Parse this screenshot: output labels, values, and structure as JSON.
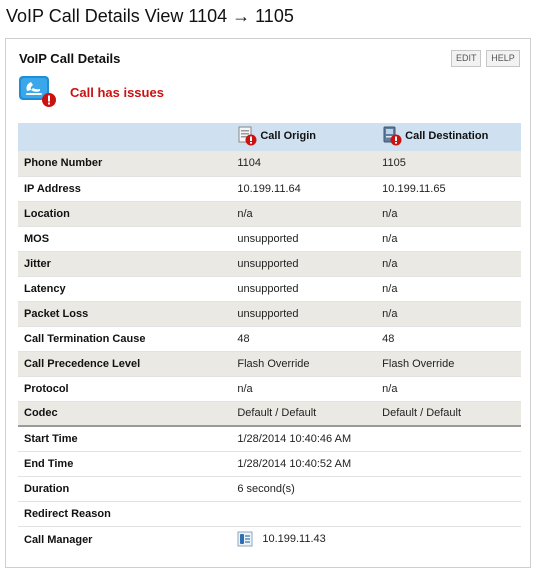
{
  "page": {
    "title": "VoIP Call Details View 1104 → 1105"
  },
  "panel": {
    "title": "VoIP Call Details",
    "edit_label": "EDIT",
    "help_label": "HELP"
  },
  "status": {
    "text": "Call has issues",
    "icon": "phone-warning-icon",
    "color": "#cc1111"
  },
  "table": {
    "columns": [
      {
        "label": "Call Origin",
        "icon": "document-warning-icon"
      },
      {
        "label": "Call Destination",
        "icon": "device-warning-icon"
      }
    ],
    "rows": [
      {
        "label": "Phone Number",
        "origin": "1104",
        "destination": "1105"
      },
      {
        "label": "IP Address",
        "origin": "10.199.11.64",
        "destination": "10.199.11.65"
      },
      {
        "label": "Location",
        "origin": "n/a",
        "destination": "n/a"
      },
      {
        "label": "MOS",
        "origin": "unsupported",
        "destination": "n/a"
      },
      {
        "label": "Jitter",
        "origin": "unsupported",
        "destination": "n/a"
      },
      {
        "label": "Latency",
        "origin": "unsupported",
        "destination": "n/a"
      },
      {
        "label": "Packet Loss",
        "origin": "unsupported",
        "destination": "n/a"
      },
      {
        "label": "Call Termination Cause",
        "origin": "48",
        "destination": "48"
      },
      {
        "label": "Call Precedence Level",
        "origin": "Flash Override",
        "destination": "Flash Override"
      },
      {
        "label": "Protocol",
        "origin": "n/a",
        "destination": "n/a"
      },
      {
        "label": "Codec",
        "origin": "Default / Default",
        "destination": "Default / Default"
      }
    ],
    "summary": [
      {
        "label": "Start Time",
        "value": "1/28/2014 10:40:46 AM"
      },
      {
        "label": "End Time",
        "value": "1/28/2014 10:40:52 AM"
      },
      {
        "label": "Duration",
        "value": "6 second(s)"
      },
      {
        "label": "Redirect Reason",
        "value": ""
      },
      {
        "label": "Call Manager",
        "value": "10.199.11.43",
        "icon": "call-manager-icon"
      }
    ]
  },
  "colors": {
    "header_bg": "#cfe0f0",
    "alt_row_bg": "#ebe9e4",
    "alert_red": "#cc1111"
  }
}
